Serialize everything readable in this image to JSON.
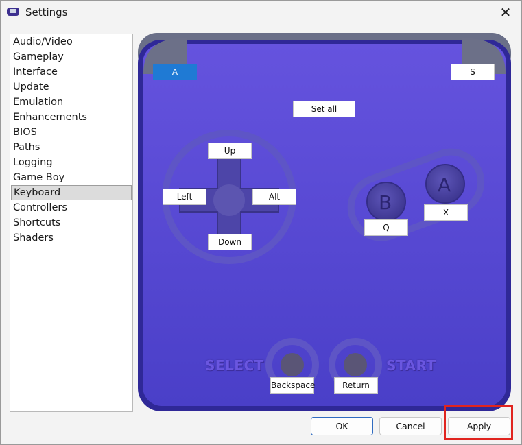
{
  "window": {
    "title": "Settings"
  },
  "sidebar": {
    "items": [
      {
        "label": "Audio/Video"
      },
      {
        "label": "Gameplay"
      },
      {
        "label": "Interface"
      },
      {
        "label": "Update"
      },
      {
        "label": "Emulation"
      },
      {
        "label": "Enhancements"
      },
      {
        "label": "BIOS"
      },
      {
        "label": "Paths"
      },
      {
        "label": "Logging"
      },
      {
        "label": "Game Boy"
      },
      {
        "label": "Keyboard"
      },
      {
        "label": "Controllers"
      },
      {
        "label": "Shortcuts"
      },
      {
        "label": "Shaders"
      }
    ],
    "selected": "Keyboard"
  },
  "keys": {
    "l_shoulder": "A",
    "r_shoulder": "S",
    "set_all": "Set all",
    "up": "Up",
    "left": "Left",
    "right": "Alt",
    "down": "Down",
    "b_button": "Q",
    "a_button": "X",
    "select": "Backspace",
    "start": "Return"
  },
  "labels": {
    "select": "SELECT",
    "start": "START",
    "a_face": "A",
    "b_face": "B"
  },
  "buttons": {
    "ok": "OK",
    "cancel": "Cancel",
    "apply": "Apply"
  },
  "colors": {
    "body": "#4b3fc7",
    "body_dark": "#2d2494",
    "selection": "#1f7ad4",
    "highlight": "#e0241f"
  }
}
